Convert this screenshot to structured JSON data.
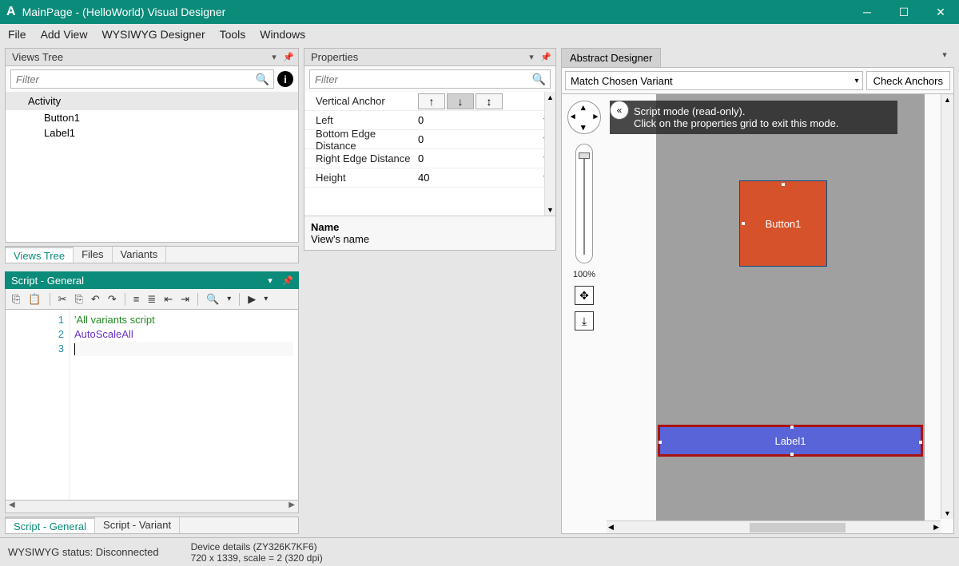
{
  "title": "MainPage - (HelloWorld) Visual Designer",
  "app_letter": "A",
  "menu": [
    "File",
    "Add View",
    "WYSIWYG Designer",
    "Tools",
    "Windows"
  ],
  "views_tree": {
    "title": "Views Tree",
    "filter_placeholder": "Filter",
    "root": "Activity",
    "items": [
      "Button1",
      "Label1"
    ],
    "tabs": [
      "Views Tree",
      "Files",
      "Variants"
    ],
    "active_tab": 0
  },
  "properties": {
    "title": "Properties",
    "filter_placeholder": "Filter",
    "rows": [
      {
        "name": "Vertical Anchor",
        "value": ""
      },
      {
        "name": "Left",
        "value": "0"
      },
      {
        "name": "Bottom Edge Distance",
        "value": "0"
      },
      {
        "name": "Right Edge Distance",
        "value": "0"
      },
      {
        "name": "Height",
        "value": "40"
      }
    ],
    "desc_name": "Name",
    "desc_text": "View's name"
  },
  "script": {
    "title": "Script - General",
    "lines": [
      {
        "n": 1,
        "text": "'All variants script",
        "cls": "c-comment"
      },
      {
        "n": 2,
        "text": "AutoScaleAll",
        "cls": "c-ident"
      },
      {
        "n": 3,
        "text": "",
        "cls": ""
      }
    ],
    "tabs": [
      "Script - General",
      "Script - Variant"
    ]
  },
  "designer": {
    "tab": "Abstract Designer",
    "variant_label": "Match Chosen Variant",
    "check_anchors": "Check Anchors",
    "zoom": "100%",
    "banner_line1": "Script mode (read-only).",
    "banner_line2": "Click on the properties grid to exit this mode.",
    "button_label": "Button1",
    "label_label": "Label1"
  },
  "status": {
    "wysiwyg": "WYSIWYG status: Disconnected",
    "device_line1": "Device details (ZY326K7KF6)",
    "device_line2": "720 x 1339, scale = 2 (320 dpi)"
  }
}
